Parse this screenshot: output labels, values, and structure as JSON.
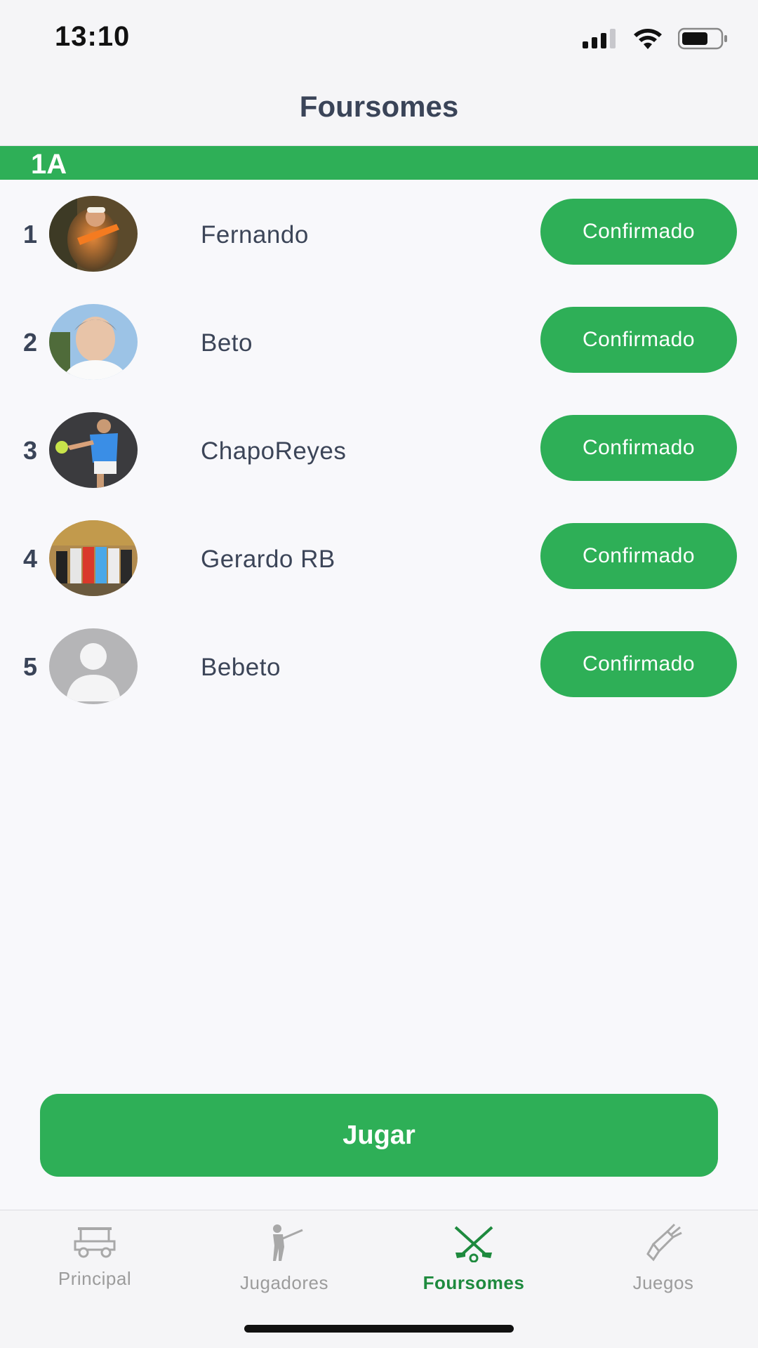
{
  "status_bar": {
    "time": "13:10"
  },
  "nav": {
    "title": "Foursomes"
  },
  "group": {
    "label": "1A"
  },
  "players": [
    {
      "number": "1",
      "name": "Fernando",
      "status": "Confirmado"
    },
    {
      "number": "2",
      "name": "Beto",
      "status": "Confirmado"
    },
    {
      "number": "3",
      "name": "ChapoReyes",
      "status": "Confirmado"
    },
    {
      "number": "4",
      "name": "Gerardo RB",
      "status": "Confirmado"
    },
    {
      "number": "5",
      "name": "Bebeto",
      "status": "Confirmado"
    }
  ],
  "play_button": {
    "label": "Jugar"
  },
  "tabs": [
    {
      "label": "Principal",
      "icon": "golf-cart-icon"
    },
    {
      "label": "Jugadores",
      "icon": "golfer-icon"
    },
    {
      "label": "Foursomes",
      "icon": "crossed-clubs-icon"
    },
    {
      "label": "Juegos",
      "icon": "golf-bag-icon"
    }
  ],
  "colors": {
    "accent": "#2eaf57",
    "active_tab": "#1e8a3e",
    "inactive_tab": "#9c9c9c",
    "text": "#3c4558"
  }
}
